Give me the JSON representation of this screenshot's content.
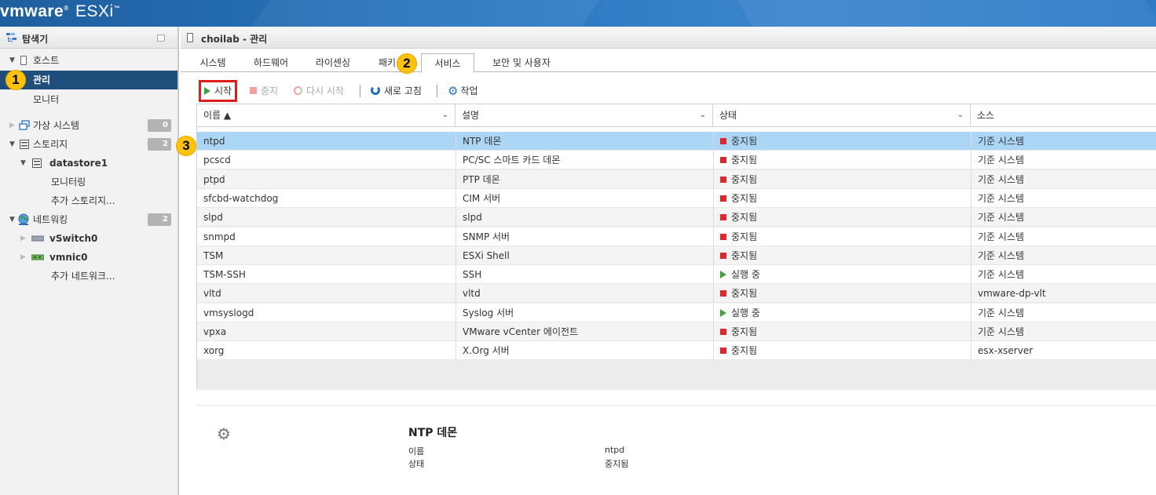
{
  "app": {
    "brand_vm": "vm",
    "brand_ware": "ware",
    "brand_reg": "®",
    "brand_esxi": "ESXi",
    "brand_tm": "™"
  },
  "navigator": {
    "title": "탐색기",
    "items": [
      {
        "label": "호스트"
      },
      {
        "label": "관리"
      },
      {
        "label": "모니터"
      },
      {
        "label": "가상 시스템",
        "count": "0"
      },
      {
        "label": "스토리지",
        "count": "2"
      },
      {
        "label": "datastore1"
      },
      {
        "label": "모니터링"
      },
      {
        "label": "추가 스토리지..."
      },
      {
        "label": "네트워킹",
        "count": "2"
      },
      {
        "label": "vSwitch0"
      },
      {
        "label": "vmnic0"
      },
      {
        "label": "추가 네트워크..."
      }
    ]
  },
  "content": {
    "title": "choilab - 관리",
    "tabs": [
      "시스템",
      "하드웨어",
      "라이센싱",
      "패키",
      "서비스",
      "보안 및 사용자"
    ],
    "toolbar": {
      "start": "시작",
      "stop": "중지",
      "restart": "다시 시작",
      "refresh": "새로 고침",
      "actions": "작업"
    },
    "table": {
      "columns": [
        "이름 ▲",
        "설명",
        "상태",
        "소스"
      ],
      "rows": [
        {
          "name": "ntpd",
          "desc": "NTP 데몬",
          "status": "중지됨",
          "state": "stopped",
          "source": "기준 시스템"
        },
        {
          "name": "pcscd",
          "desc": "PC/SC 스마트 카드 데몬",
          "status": "중지됨",
          "state": "stopped",
          "source": "기준 시스템"
        },
        {
          "name": "ptpd",
          "desc": "PTP 데몬",
          "status": "중지됨",
          "state": "stopped",
          "source": "기준 시스템"
        },
        {
          "name": "sfcbd-watchdog",
          "desc": "CIM 서버",
          "status": "중지됨",
          "state": "stopped",
          "source": "기준 시스템"
        },
        {
          "name": "slpd",
          "desc": "slpd",
          "status": "중지됨",
          "state": "stopped",
          "source": "기준 시스템"
        },
        {
          "name": "snmpd",
          "desc": "SNMP 서버",
          "status": "중지됨",
          "state": "stopped",
          "source": "기준 시스템"
        },
        {
          "name": "TSM",
          "desc": "ESXi Shell",
          "status": "중지됨",
          "state": "stopped",
          "source": "기준 시스템"
        },
        {
          "name": "TSM-SSH",
          "desc": "SSH",
          "status": "실행 중",
          "state": "running",
          "source": "기준 시스템"
        },
        {
          "name": "vltd",
          "desc": "vltd",
          "status": "중지됨",
          "state": "stopped",
          "source": "vmware-dp-vlt"
        },
        {
          "name": "vmsyslogd",
          "desc": "Syslog 서버",
          "status": "실행 중",
          "state": "running",
          "source": "기준 시스템"
        },
        {
          "name": "vpxa",
          "desc": "VMware vCenter 에이전트",
          "status": "중지됨",
          "state": "stopped",
          "source": "기준 시스템"
        },
        {
          "name": "xorg",
          "desc": "X.Org 서버",
          "status": "중지됨",
          "state": "stopped",
          "source": "esx-xserver"
        }
      ]
    },
    "detail": {
      "title": "NTP 데몬",
      "name_label": "이름",
      "name_value": "ntpd",
      "status_label": "상태",
      "status_value": "중지됨"
    }
  },
  "annotations": [
    "1",
    "2",
    "3"
  ],
  "colors": {
    "selected_nav": "#1f4e7a",
    "selected_row": "#abd6f5",
    "highlight": "#e21b1b",
    "badge": "#ffc20e"
  }
}
